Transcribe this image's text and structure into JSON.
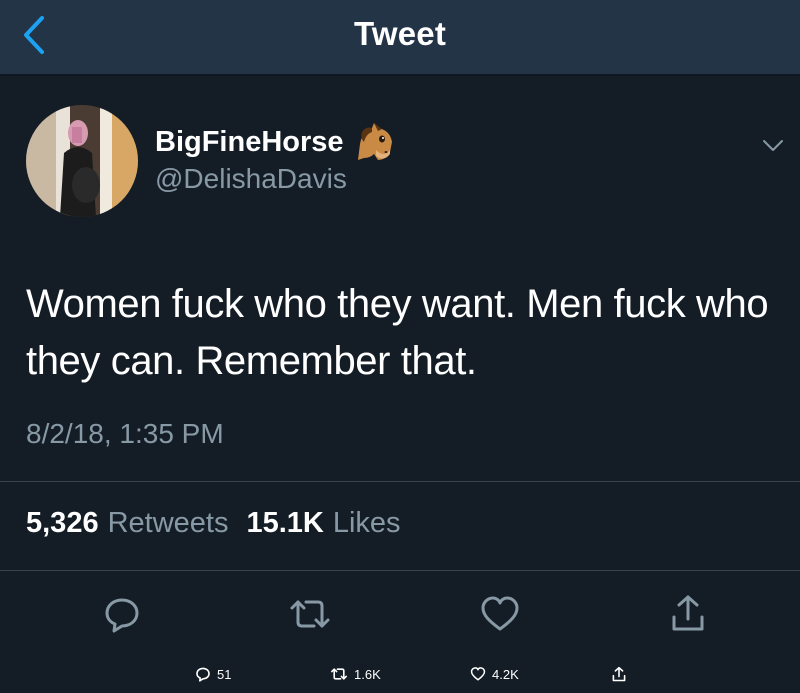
{
  "header": {
    "title": "Tweet",
    "back_icon": "chevron-left-icon",
    "accent_color": "#1da1f2"
  },
  "author": {
    "display_name": "BigFineHorse",
    "handle": "@DelishaDavis",
    "emoji": "horse-face-emoji"
  },
  "tweet": {
    "text": "Women fuck who they want. Men fuck who they can. Remember that.",
    "timestamp": "8/2/18, 1:35 PM"
  },
  "stats": {
    "retweets_count": "5,326",
    "retweets_label": "Retweets",
    "likes_count": "15.1K",
    "likes_label": "Likes"
  },
  "actions": [
    {
      "name": "reply",
      "icon": "reply-icon"
    },
    {
      "name": "retweet",
      "icon": "retweet-icon"
    },
    {
      "name": "like",
      "icon": "heart-icon"
    },
    {
      "name": "share",
      "icon": "share-icon"
    }
  ],
  "mini_bar": {
    "reply_count": "51",
    "retweet_count": "1.6K",
    "like_count": "4.2K"
  }
}
